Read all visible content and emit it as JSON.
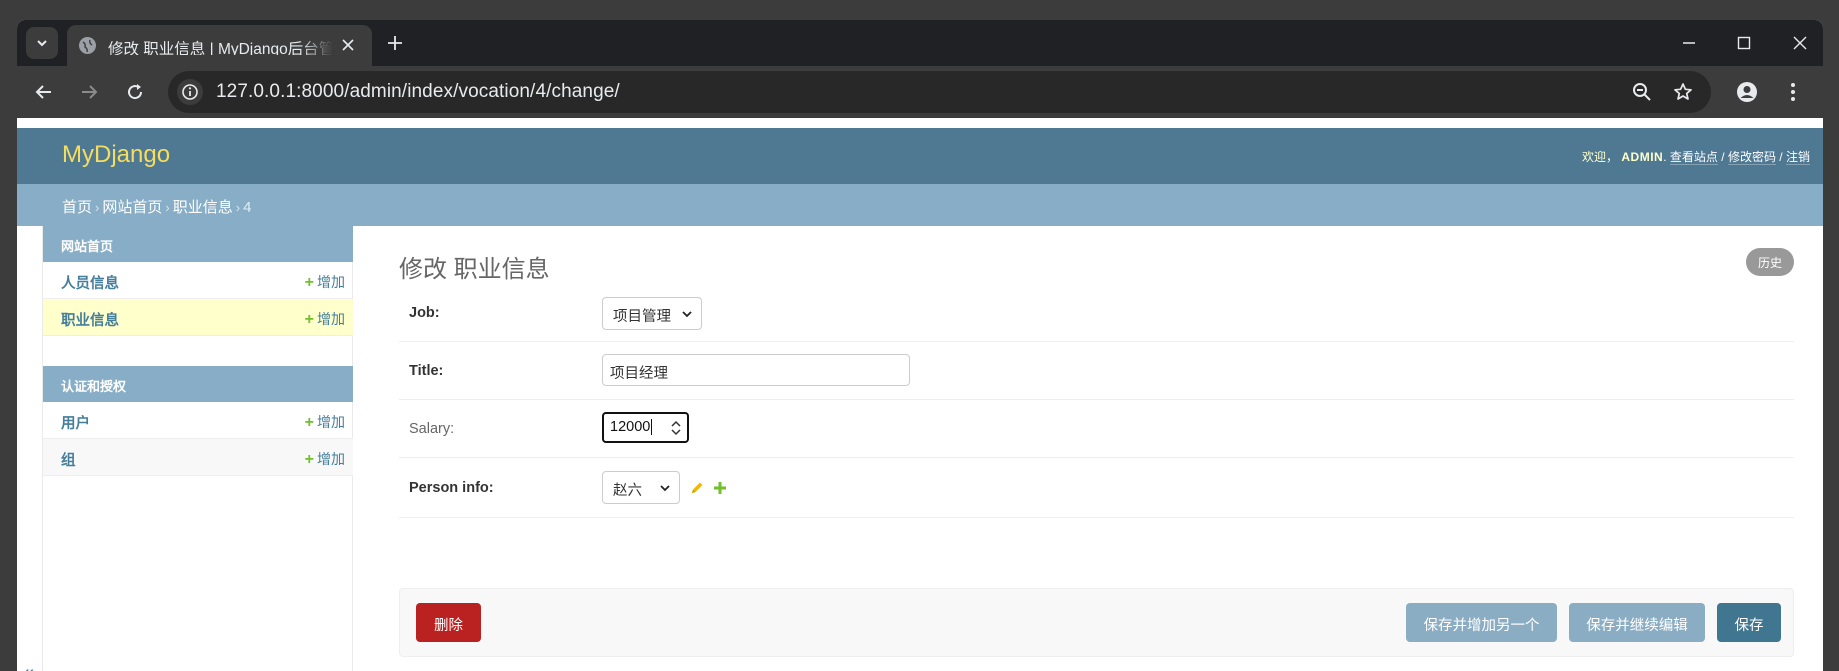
{
  "browser": {
    "tab_title": "修改 职业信息 | MyDjango后台管理",
    "url": "127.0.0.1:8000/admin/index/vocation/4/change/"
  },
  "header": {
    "brand": "MyDjango",
    "welcome": "欢迎，",
    "username": "ADMIN",
    "view_site": "查看站点",
    "change_password": "修改密码",
    "logout": "注销",
    "sep": "/"
  },
  "breadcrumbs": {
    "home": "首页",
    "app": "网站首页",
    "model": "职业信息",
    "current": "4",
    "arrow": "›"
  },
  "sidebar": {
    "modules": [
      {
        "caption": "网站首页",
        "models": [
          {
            "name": "人员信息",
            "add": "增加"
          },
          {
            "name": "职业信息",
            "add": "增加"
          }
        ]
      },
      {
        "caption": "认证和授权",
        "models": [
          {
            "name": "用户",
            "add": "增加"
          },
          {
            "name": "组",
            "add": "增加"
          }
        ]
      }
    ],
    "collapse": "«"
  },
  "content": {
    "title": "修改 职业信息",
    "history": "历史"
  },
  "form": {
    "job": {
      "label": "Job:",
      "value": "项目管理"
    },
    "title": {
      "label": "Title:",
      "value": "项目经理"
    },
    "salary": {
      "label": "Salary:",
      "value": "12000"
    },
    "person_info": {
      "label": "Person info:",
      "value": "赵六"
    }
  },
  "submit": {
    "delete": "删除",
    "save_add_another": "保存并增加另一个",
    "save_continue": "保存并继续编辑",
    "save": "保存"
  },
  "colors": {
    "header_bg": "#4f7893",
    "breadcrumb_bg": "#87aec6",
    "brand": "#f5dd5d",
    "link": "#447e9b",
    "add_plus": "#70bf2b",
    "delete": "#ba2121",
    "save": "#417690"
  }
}
